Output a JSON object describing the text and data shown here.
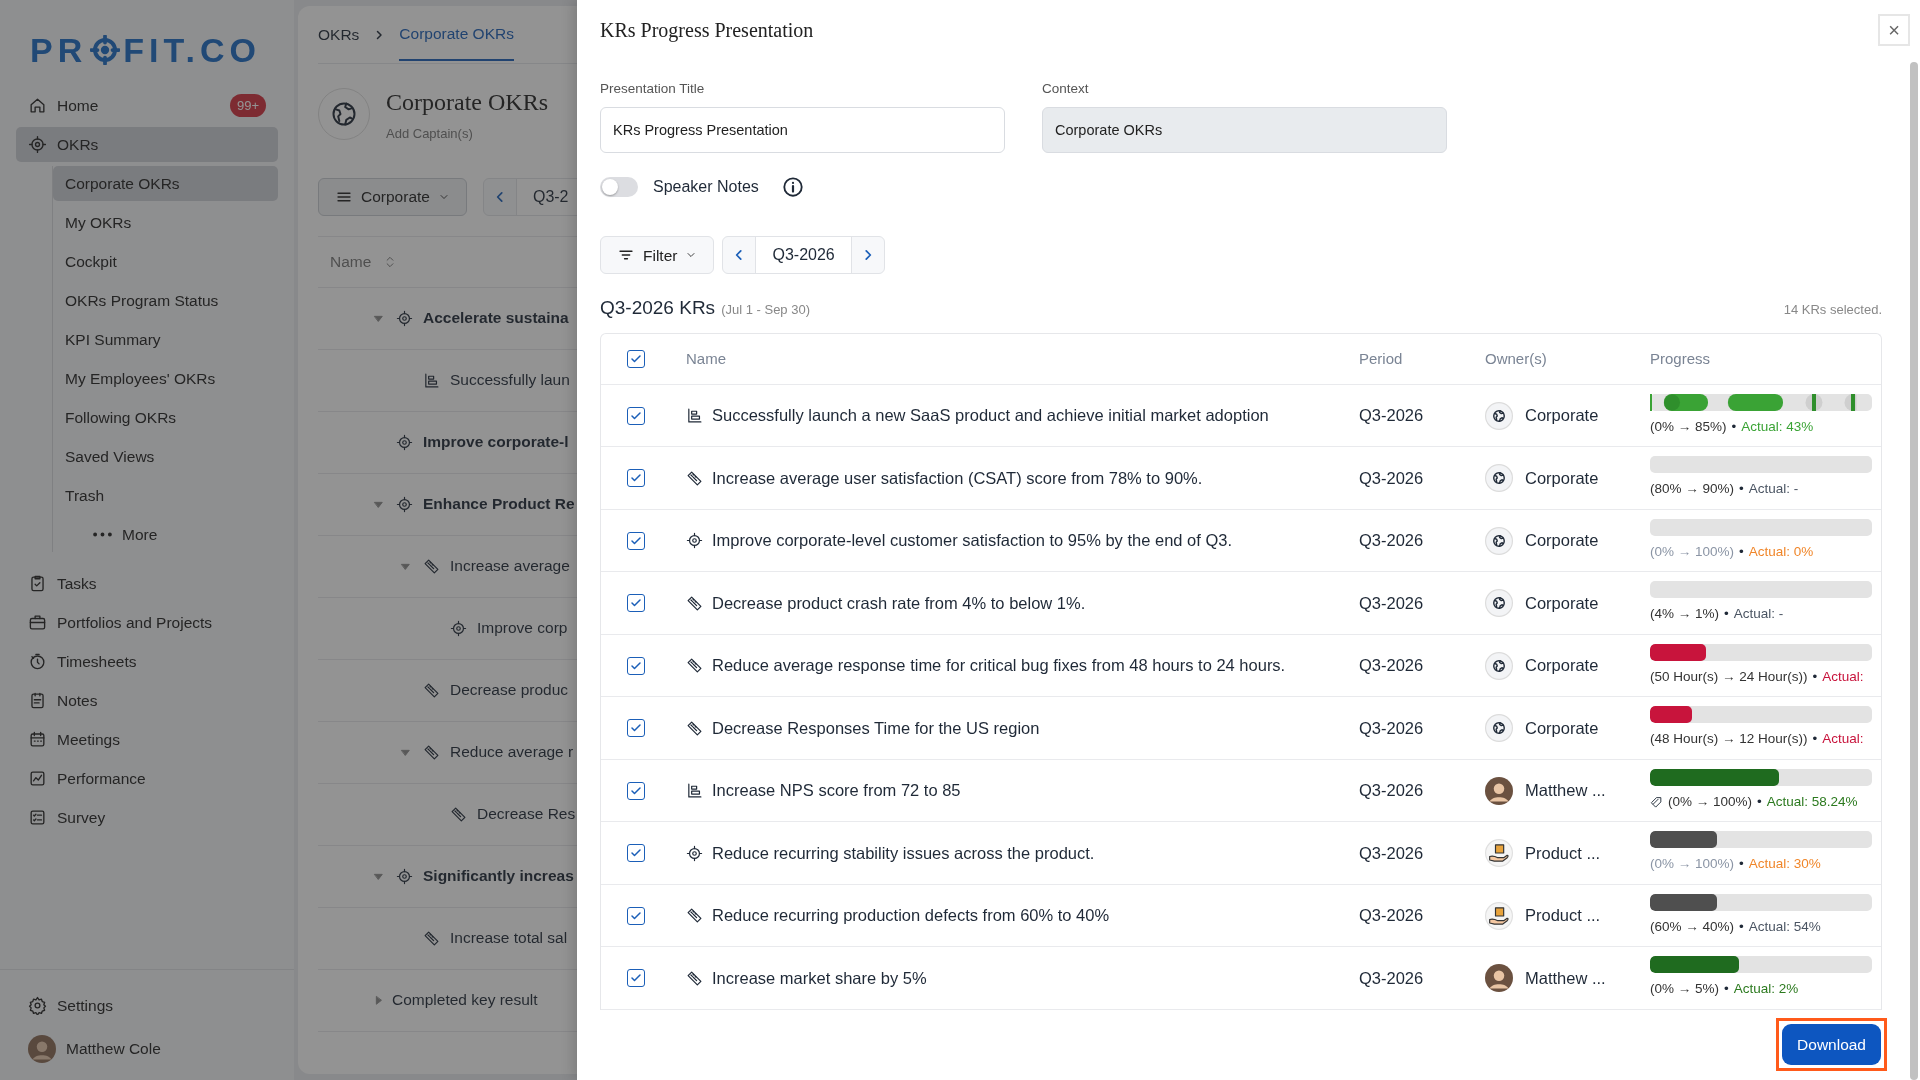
{
  "sidebar": {
    "logo": {
      "before": "PR",
      "after": "FIT.CO"
    },
    "items": [
      {
        "label": "Home",
        "badge": "99+",
        "selected": false
      },
      {
        "label": "OKRs",
        "selected": true,
        "expanded": true,
        "children": [
          {
            "label": "Corporate OKRs",
            "selected": true
          },
          {
            "label": "My OKRs",
            "selected": false
          },
          {
            "label": "Cockpit",
            "selected": false
          },
          {
            "label": "OKRs Program Status",
            "selected": false
          },
          {
            "label": "KPI Summary",
            "selected": false
          },
          {
            "label": "My Employees' OKRs",
            "selected": false
          },
          {
            "label": "Following OKRs",
            "selected": false
          },
          {
            "label": "Saved Views",
            "selected": false
          },
          {
            "label": "Trash",
            "selected": false
          },
          {
            "label": "More",
            "kind": "more",
            "selected": false
          }
        ]
      },
      {
        "label": "Tasks",
        "selected": false
      },
      {
        "label": "Portfolios and Projects",
        "selected": false
      },
      {
        "label": "Timesheets",
        "selected": false
      },
      {
        "label": "Notes",
        "selected": false
      },
      {
        "label": "Meetings",
        "selected": false
      },
      {
        "label": "Performance",
        "selected": false
      },
      {
        "label": "Survey",
        "selected": false
      }
    ],
    "settings": "Settings",
    "user": "Matthew Cole"
  },
  "page": {
    "breadcrumb": [
      {
        "label": "OKRs",
        "selected": false
      },
      {
        "label": "Corporate OKRs",
        "selected": true
      }
    ],
    "title": "Corporate OKRs",
    "subtitle": "Add Captain(s)",
    "view": "Corporate",
    "period": "Q3-2",
    "name_column": "Name",
    "tree": [
      {
        "label": "Accelerate sustaina",
        "kind": "objective",
        "expanded": true,
        "children": [
          {
            "label": "Successfully laun",
            "kind": "metric"
          }
        ]
      },
      {
        "label": "Improve corporate-l",
        "kind": "objective"
      },
      {
        "label": "Enhance Product Re",
        "kind": "objective",
        "expanded": true,
        "children": [
          {
            "label": "Increase average",
            "kind": "kr",
            "expanded": true,
            "children": [
              {
                "label": "Improve corp",
                "kind": "objective"
              }
            ]
          },
          {
            "label": "Decrease produc",
            "kind": "kr"
          },
          {
            "label": "Reduce average r",
            "kind": "kr",
            "expanded": true,
            "children": [
              {
                "label": "Decrease Res",
                "kind": "kr"
              }
            ]
          }
        ]
      },
      {
        "label": "Significantly increas",
        "kind": "objective",
        "expanded": true,
        "children": [
          {
            "label": "Increase total sal",
            "kind": "kr"
          }
        ]
      },
      {
        "label": "Completed key result",
        "kind": "group",
        "expanded": false
      }
    ]
  },
  "modal": {
    "title": "KRs Progress Presentation",
    "close": "×",
    "fields": [
      {
        "label": "Presentation Title",
        "value": "KRs Progress Presentation",
        "disabled": false
      },
      {
        "label": "Context",
        "value": "Corporate OKRs",
        "disabled": true
      }
    ],
    "speaker_notes": {
      "label": "Speaker Notes",
      "on": false
    },
    "filter": "Filter",
    "period": "Q3-2026",
    "heading": "Q3-2026 KRs",
    "range": "(Jul 1 - Sep 30)",
    "selected_count": "14 KRs selected.",
    "columns": [
      "Name",
      "Period",
      "Owner(s)",
      "Progress"
    ],
    "all_checked": true,
    "rows": [
      {
        "checked": true,
        "kind": "metric",
        "name": "Successfully launch a new SaaS product and achieve initial market adoption",
        "period": "Q3-2026",
        "owner": {
          "name": "Corporate",
          "kind": "globe"
        },
        "progress": {
          "kind": "segmented",
          "level": 0.93,
          "range": {
            "text": "(0% → 85%)",
            "muted": false
          },
          "separator": "•",
          "actual": {
            "text": "Actual: 43%",
            "color": "#3aa335"
          }
        }
      },
      {
        "checked": true,
        "kind": "kr",
        "name": "Increase average user satisfaction (CSAT) score from 78% to 90%.",
        "period": "Q3-2026",
        "owner": {
          "name": "Corporate",
          "kind": "globe"
        },
        "progress": {
          "kind": "bar",
          "fill": {
            "level": 0
          },
          "range": {
            "text": "(80% → 90%)",
            "muted": false
          },
          "separator": "•",
          "actual": {
            "text": "Actual: -",
            "color": "#4b5563"
          }
        }
      },
      {
        "checked": true,
        "kind": "objective",
        "name": "Improve corporate-level customer satisfaction to 95% by the end of Q3.",
        "period": "Q3-2026",
        "owner": {
          "name": "Corporate",
          "kind": "globe"
        },
        "progress": {
          "kind": "bar",
          "fill": {
            "level": 0
          },
          "range": {
            "text": "(0% → 100%)",
            "muted": true
          },
          "separator": "•",
          "actual": {
            "text": "Actual: 0%",
            "color": "#f0862a"
          }
        }
      },
      {
        "checked": true,
        "kind": "kr",
        "name": "Decrease product crash rate from 4% to below 1%.",
        "period": "Q3-2026",
        "owner": {
          "name": "Corporate",
          "kind": "globe"
        },
        "progress": {
          "kind": "bar",
          "fill": {
            "level": 0
          },
          "range": {
            "text": "(4% → 1%)",
            "muted": false
          },
          "separator": "•",
          "actual": {
            "text": "Actual: -",
            "color": "#4b5563"
          }
        }
      },
      {
        "checked": true,
        "kind": "kr",
        "name": "Reduce average response time for critical bug fixes from 48 hours to 24 hours.",
        "period": "Q3-2026",
        "owner": {
          "name": "Corporate",
          "kind": "globe"
        },
        "progress": {
          "kind": "bar",
          "fill": {
            "level": 0.25,
            "color": "#c8143c"
          },
          "range": {
            "text": "(50 Hour(s) → 24 Hour(s))",
            "muted": false
          },
          "separator": "•",
          "actual": {
            "text": "Actual:",
            "color": "#c8143c"
          }
        }
      },
      {
        "checked": true,
        "kind": "kr",
        "name": "Decrease Responses Time for the US region",
        "period": "Q3-2026",
        "owner": {
          "name": "Corporate",
          "kind": "globe"
        },
        "progress": {
          "kind": "bar",
          "fill": {
            "level": 0.19,
            "color": "#c8143c"
          },
          "range": {
            "text": "(48 Hour(s) → 12 Hour(s))",
            "muted": false
          },
          "separator": "•",
          "actual": {
            "text": "Actual:",
            "color": "#c8143c"
          }
        }
      },
      {
        "checked": true,
        "kind": "metric",
        "name": "Increase NPS score from 72 to 85",
        "period": "Q3-2026",
        "owner": {
          "name": "Matthew ...",
          "kind": "person"
        },
        "progress": {
          "kind": "bar",
          "fill": {
            "level": 0.58,
            "color": "#1f6b1f"
          },
          "range_icon": true,
          "range": {
            "text": "(0% → 100%)",
            "muted": false
          },
          "separator": "•",
          "actual": {
            "text": "Actual: 58.24%",
            "color": "#2c7a1f"
          }
        }
      },
      {
        "checked": true,
        "kind": "objective",
        "name": "Reduce recurring stability issues across the product.",
        "period": "Q3-2026",
        "owner": {
          "name": "Product ...",
          "kind": "product"
        },
        "progress": {
          "kind": "bar",
          "fill": {
            "level": 0.3,
            "color": "#4f4f4f"
          },
          "range": {
            "text": "(0% → 100%)",
            "muted": true
          },
          "separator": "•",
          "actual": {
            "text": "Actual: 30%",
            "color": "#f0862a"
          }
        }
      },
      {
        "checked": true,
        "kind": "kr",
        "name": "Reduce recurring production defects from 60% to 40%",
        "period": "Q3-2026",
        "owner": {
          "name": "Product ...",
          "kind": "product"
        },
        "progress": {
          "kind": "bar",
          "fill": {
            "level": 0.3,
            "color": "#4f4f4f"
          },
          "range": {
            "text": "(60% → 40%)",
            "muted": false
          },
          "separator": "•",
          "actual": {
            "text": "Actual: 54%",
            "color": "#4b5563"
          }
        }
      },
      {
        "checked": true,
        "kind": "kr",
        "name": "Increase market share by 5%",
        "period": "Q3-2026",
        "owner": {
          "name": "Matthew ...",
          "kind": "person"
        },
        "progress": {
          "kind": "bar",
          "fill": {
            "level": 0.4,
            "color": "#1f6b1f"
          },
          "range": {
            "text": "(0% → 5%)",
            "muted": false
          },
          "separator": "•",
          "actual": {
            "text": "Actual: 2%",
            "color": "#2c7a1f"
          }
        }
      }
    ],
    "download": {
      "label": "Download",
      "highlighted": true
    }
  }
}
